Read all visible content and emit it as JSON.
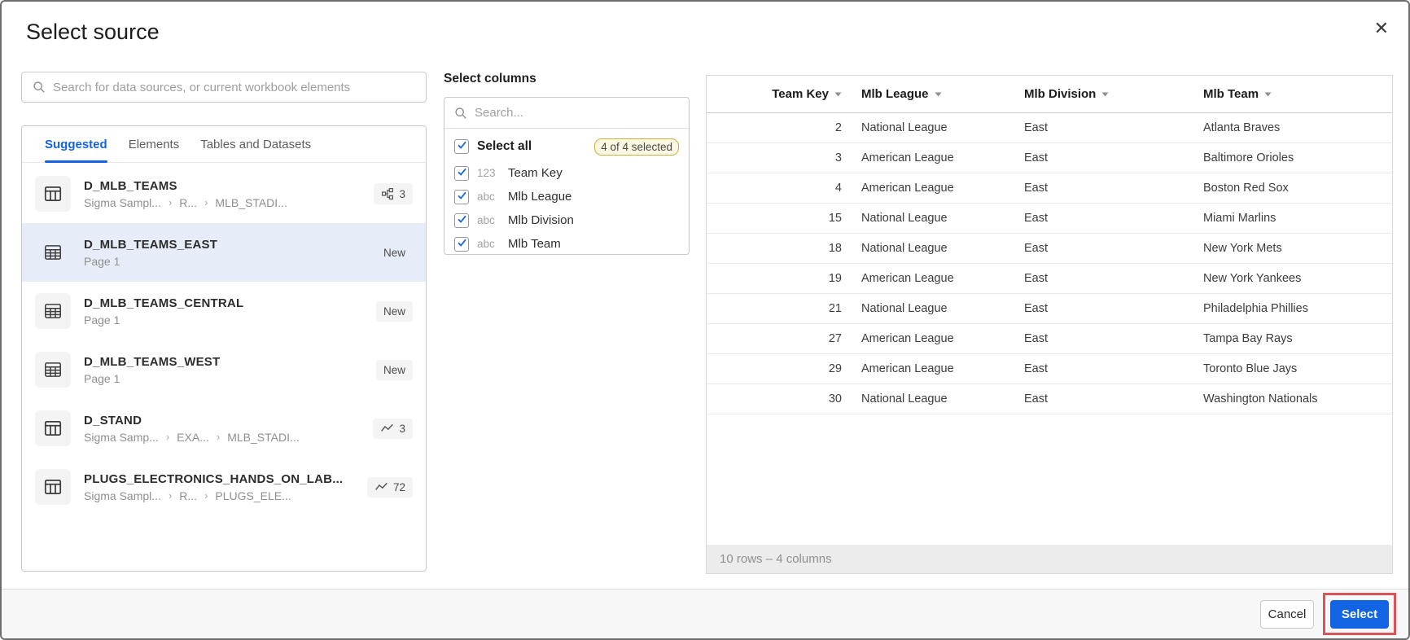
{
  "dialog": {
    "title": "Select source",
    "close_icon": "✕"
  },
  "source_panel": {
    "search_placeholder": "Search for data sources, or current workbook elements",
    "tabs": [
      {
        "label": "Suggested",
        "active": true
      },
      {
        "label": "Elements",
        "active": false
      },
      {
        "label": "Tables and Datasets",
        "active": false
      }
    ],
    "items": [
      {
        "title": "D_MLB_TEAMS",
        "breadcrumb": [
          "Sigma Sampl...",
          "R...",
          "MLB_STADI..."
        ],
        "icon": "dataset-table-icon",
        "badge": {
          "kind": "lineage",
          "icon": "lineage-icon",
          "count": "3"
        },
        "selected": false
      },
      {
        "title": "D_MLB_TEAMS_EAST",
        "breadcrumb": [
          "Page 1"
        ],
        "icon": "grid-table-icon",
        "badge": {
          "kind": "new",
          "label": "New"
        },
        "selected": true
      },
      {
        "title": "D_MLB_TEAMS_CENTRAL",
        "breadcrumb": [
          "Page 1"
        ],
        "icon": "grid-table-icon",
        "badge": {
          "kind": "new",
          "label": "New"
        },
        "selected": false
      },
      {
        "title": "D_MLB_TEAMS_WEST",
        "breadcrumb": [
          "Page 1"
        ],
        "icon": "grid-table-icon",
        "badge": {
          "kind": "new",
          "label": "New"
        },
        "selected": false
      },
      {
        "title": "D_STAND",
        "breadcrumb": [
          "Sigma Samp...",
          "EXA...",
          "MLB_STADI..."
        ],
        "icon": "dataset-table-icon",
        "badge": {
          "kind": "chart",
          "icon": "line-chart-icon",
          "count": "3"
        },
        "selected": false
      },
      {
        "title": "PLUGS_ELECTRONICS_HANDS_ON_LAB...",
        "breadcrumb": [
          "Sigma Sampl...",
          "R...",
          "PLUGS_ELE..."
        ],
        "icon": "dataset-table-icon",
        "badge": {
          "kind": "chart",
          "icon": "line-chart-icon",
          "count": "72"
        },
        "selected": false
      }
    ]
  },
  "columns_panel": {
    "title": "Select columns",
    "search_placeholder": "Search...",
    "select_all": {
      "label": "Select all",
      "badge": "4 of 4 selected",
      "checked": true
    },
    "columns": [
      {
        "type": "123",
        "label": "Team Key",
        "checked": true
      },
      {
        "type": "abc",
        "label": "Mlb League",
        "checked": true
      },
      {
        "type": "abc",
        "label": "Mlb Division",
        "checked": true
      },
      {
        "type": "abc",
        "label": "Mlb Team",
        "checked": true
      }
    ]
  },
  "preview_table": {
    "headers": [
      "Team Key",
      "Mlb League",
      "Mlb Division",
      "Mlb Team"
    ],
    "rows": [
      [
        "2",
        "National League",
        "East",
        "Atlanta Braves"
      ],
      [
        "3",
        "American League",
        "East",
        "Baltimore Orioles"
      ],
      [
        "4",
        "American League",
        "East",
        "Boston Red Sox"
      ],
      [
        "15",
        "National League",
        "East",
        "Miami Marlins"
      ],
      [
        "18",
        "National League",
        "East",
        "New York Mets"
      ],
      [
        "19",
        "American League",
        "East",
        "New York Yankees"
      ],
      [
        "21",
        "National League",
        "East",
        "Philadelphia Phillies"
      ],
      [
        "27",
        "American League",
        "East",
        "Tampa Bay Rays"
      ],
      [
        "29",
        "American League",
        "East",
        "Toronto Blue Jays"
      ],
      [
        "30",
        "National League",
        "East",
        "Washington Nationals"
      ]
    ],
    "status": "10 rows – 4 columns"
  },
  "footer": {
    "cancel_label": "Cancel",
    "select_label": "Select"
  },
  "colors": {
    "accent": "#1264e2",
    "annotation_red": "#d95459",
    "selected_row_bg": "#e7edf8",
    "select_all_badge_bg": "#fcf7e0",
    "select_all_badge_border": "#c8b13c"
  }
}
